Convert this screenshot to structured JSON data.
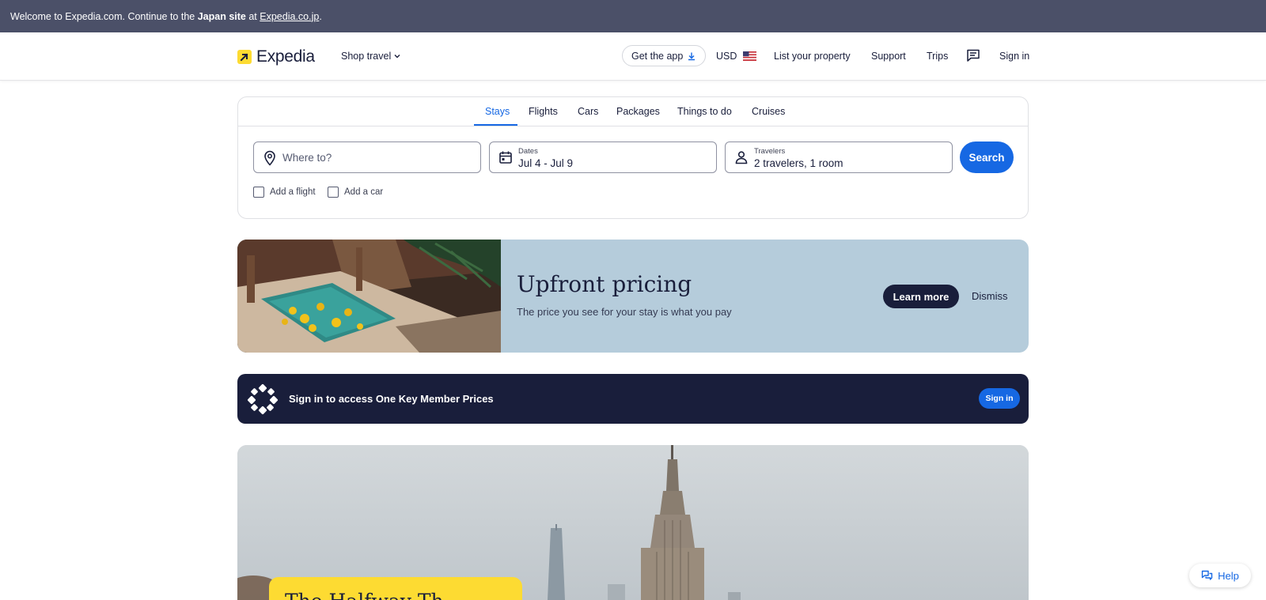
{
  "banner": {
    "prefix": "Welcome to Expedia.com. Continue to the",
    "bold": "Japan site",
    "middle": "at",
    "link": "Expedia.co.jp",
    "suffix": "."
  },
  "header": {
    "logo": "Expedia",
    "shop_travel": "Shop travel",
    "get_app": "Get the app",
    "currency": "USD",
    "list_property": "List your property",
    "support": "Support",
    "trips": "Trips",
    "sign_in": "Sign in"
  },
  "search": {
    "tabs": [
      "Stays",
      "Flights",
      "Cars",
      "Packages",
      "Things to do",
      "Cruises"
    ],
    "active_tab": "Stays",
    "destination_placeholder": "Where to?",
    "dates_label": "Dates",
    "dates_value": "Jul 4 - Jul 9",
    "travelers_label": "Travelers",
    "travelers_value": "2 travelers, 1 room",
    "search_button": "Search",
    "add_flight": "Add a flight",
    "add_car": "Add a car"
  },
  "promo": {
    "title": "Upfront pricing",
    "subtitle": "The price you see for your stay is what you pay",
    "learn_more": "Learn more",
    "dismiss": "Dismiss"
  },
  "onekey": {
    "text": "Sign in to access One Key Member Prices",
    "button": "Sign in"
  },
  "hero": {
    "card_title": "The Halfway Th"
  },
  "help": {
    "label": "Help"
  },
  "colors": {
    "brand_blue": "#1668e3",
    "navy": "#191e3b",
    "logo_yellow": "#fddb32",
    "promo_bg": "#b5ccdb",
    "banner_bg": "#4b5068"
  }
}
